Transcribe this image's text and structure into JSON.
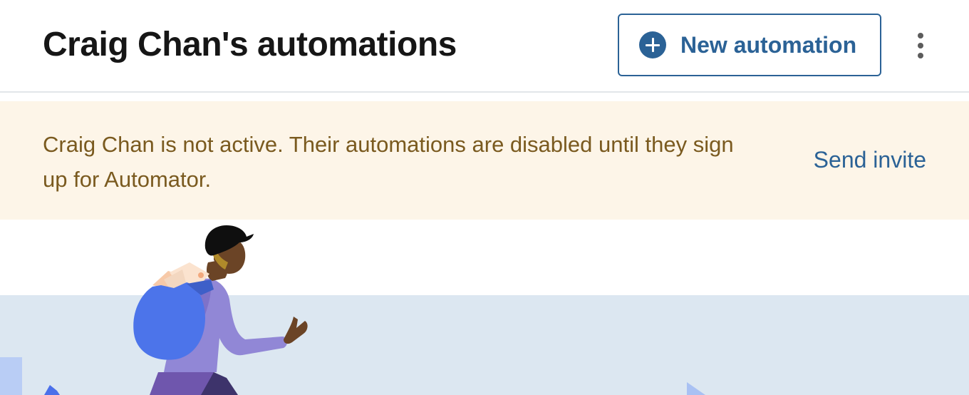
{
  "header": {
    "title": "Craig Chan's automations",
    "new_automation_label": "New automation"
  },
  "banner": {
    "message": "Craig Chan is not active. Their automations are disabled until they sign up for Automator.",
    "action_label": "Send invite"
  },
  "colors": {
    "accent": "#2b6296",
    "banner_background": "#fdf5e8",
    "banner_text": "#7a5a1f",
    "illustration_background": "#dce7f1"
  },
  "icons": {
    "new_automation": "plus-circle-icon",
    "more": "more-vertical-icon"
  }
}
